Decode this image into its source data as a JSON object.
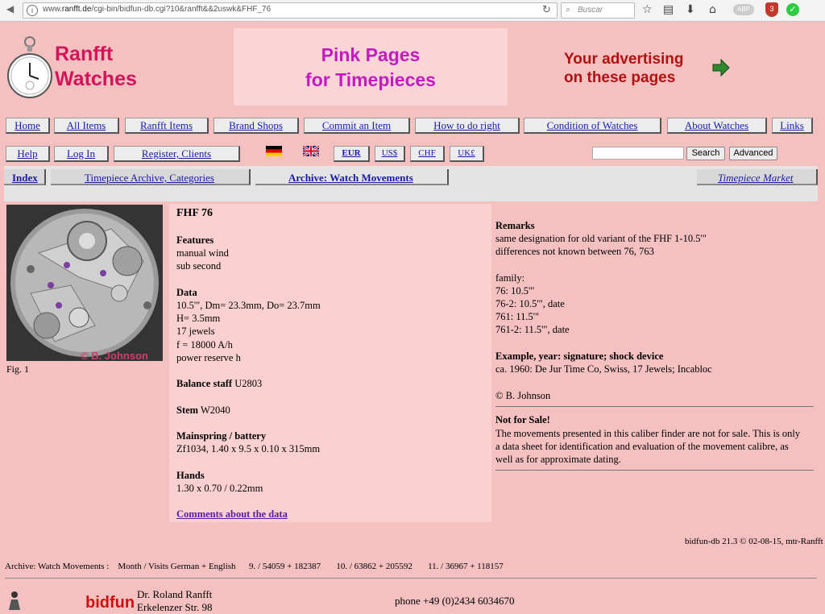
{
  "browser": {
    "url_prefix": "www.",
    "url_domain": "ranfft.de",
    "url_path": "/cgi-bin/bidfun-db.cgi?10&ranfft&&2uswk&FHF_76",
    "search_placeholder": "Buscar",
    "shield_badge": "3",
    "addon_label": "ABP"
  },
  "header": {
    "logo_line1": "Ranfft",
    "logo_line2": "Watches",
    "pink_line1": "Pink Pages",
    "pink_line2": "for Timepieces",
    "ad_line1": "Your advertising",
    "ad_line2": "on these pages"
  },
  "nav": {
    "main": [
      "Home",
      "All Items",
      "Ranfft Items",
      "Brand Shops",
      "Commit an Item",
      "How to do right",
      "Condition of Watches",
      "About Watches",
      "Links"
    ],
    "second": [
      "Help",
      "Log In",
      "Register, Clients"
    ],
    "currencies": [
      "EUR",
      "US$",
      "CHF",
      "UK£"
    ],
    "search_button": "Search",
    "advanced_button": "Advanced"
  },
  "subnav": {
    "index": "Index",
    "archive_categories": "Timepiece Archive, Categories",
    "archive_movements": "Archive: Watch Movements",
    "market": "Timepiece Market"
  },
  "caliber": {
    "title": "FHF 76",
    "fig_caption": "Fig. 1",
    "photo_credit": "© B. Johnson",
    "features_heading": "Features",
    "features": [
      "manual wind",
      "sub second"
    ],
    "data_heading": "Data",
    "data_lines": [
      "10.5'\", Dm= 23.3mm, Do= 23.7mm",
      "H= 3.5mm",
      "17 jewels",
      "f = 18000 A/h",
      "power reserve h"
    ],
    "balance_label": "Balance staff",
    "balance_value": " U2803",
    "stem_label": "Stem",
    "stem_value": " W2040",
    "mainspring_heading": "Mainspring / battery",
    "mainspring_value": "Zf1034, 1.40 x 9.5 x 0.10 x 315mm",
    "hands_heading": "Hands",
    "hands_value": "1.30 x 0.70 / 0.22mm",
    "comments_link": "Comments about the data"
  },
  "remarks": {
    "heading": "Remarks",
    "lines": [
      "same designation for old variant of the FHF 1-10.5'\"",
      "differences not known between 76, 763",
      "",
      "family:",
      "76: 10.5'\"",
      "76-2: 10.5'\", date",
      "761: 11.5'\"",
      "761-2: 11.5'\", date"
    ],
    "example_heading": "Example, year: signature; shock device",
    "example_value": "ca. 1960: De Jur Time Co, Swiss, 17 Jewels; Incabloc",
    "copyright": "© B. Johnson",
    "notsale_heading": "Not for Sale!",
    "notsale_lines": [
      "The movements presented in this caliber finder are not for sale. This is only",
      "a data sheet for identification and evaluation of the movement calibre, as",
      "well as for approximate dating."
    ]
  },
  "footer": {
    "version": "bidfun-db 21.3 © 02-08-15, mtr-Ranfft",
    "stats": "Archive: Watch Movements :    Month / Visits German + English      9. / 54059 + 182387       10. / 63862 + 205592       11. / 36967 + 118157",
    "bidfun_logo": "bidfun",
    "contact_name": "Dr. Roland Ranfft",
    "contact_street": "Erkelenzer Str. 98",
    "contact_phone": "phone +49 (0)2434 6034670"
  }
}
